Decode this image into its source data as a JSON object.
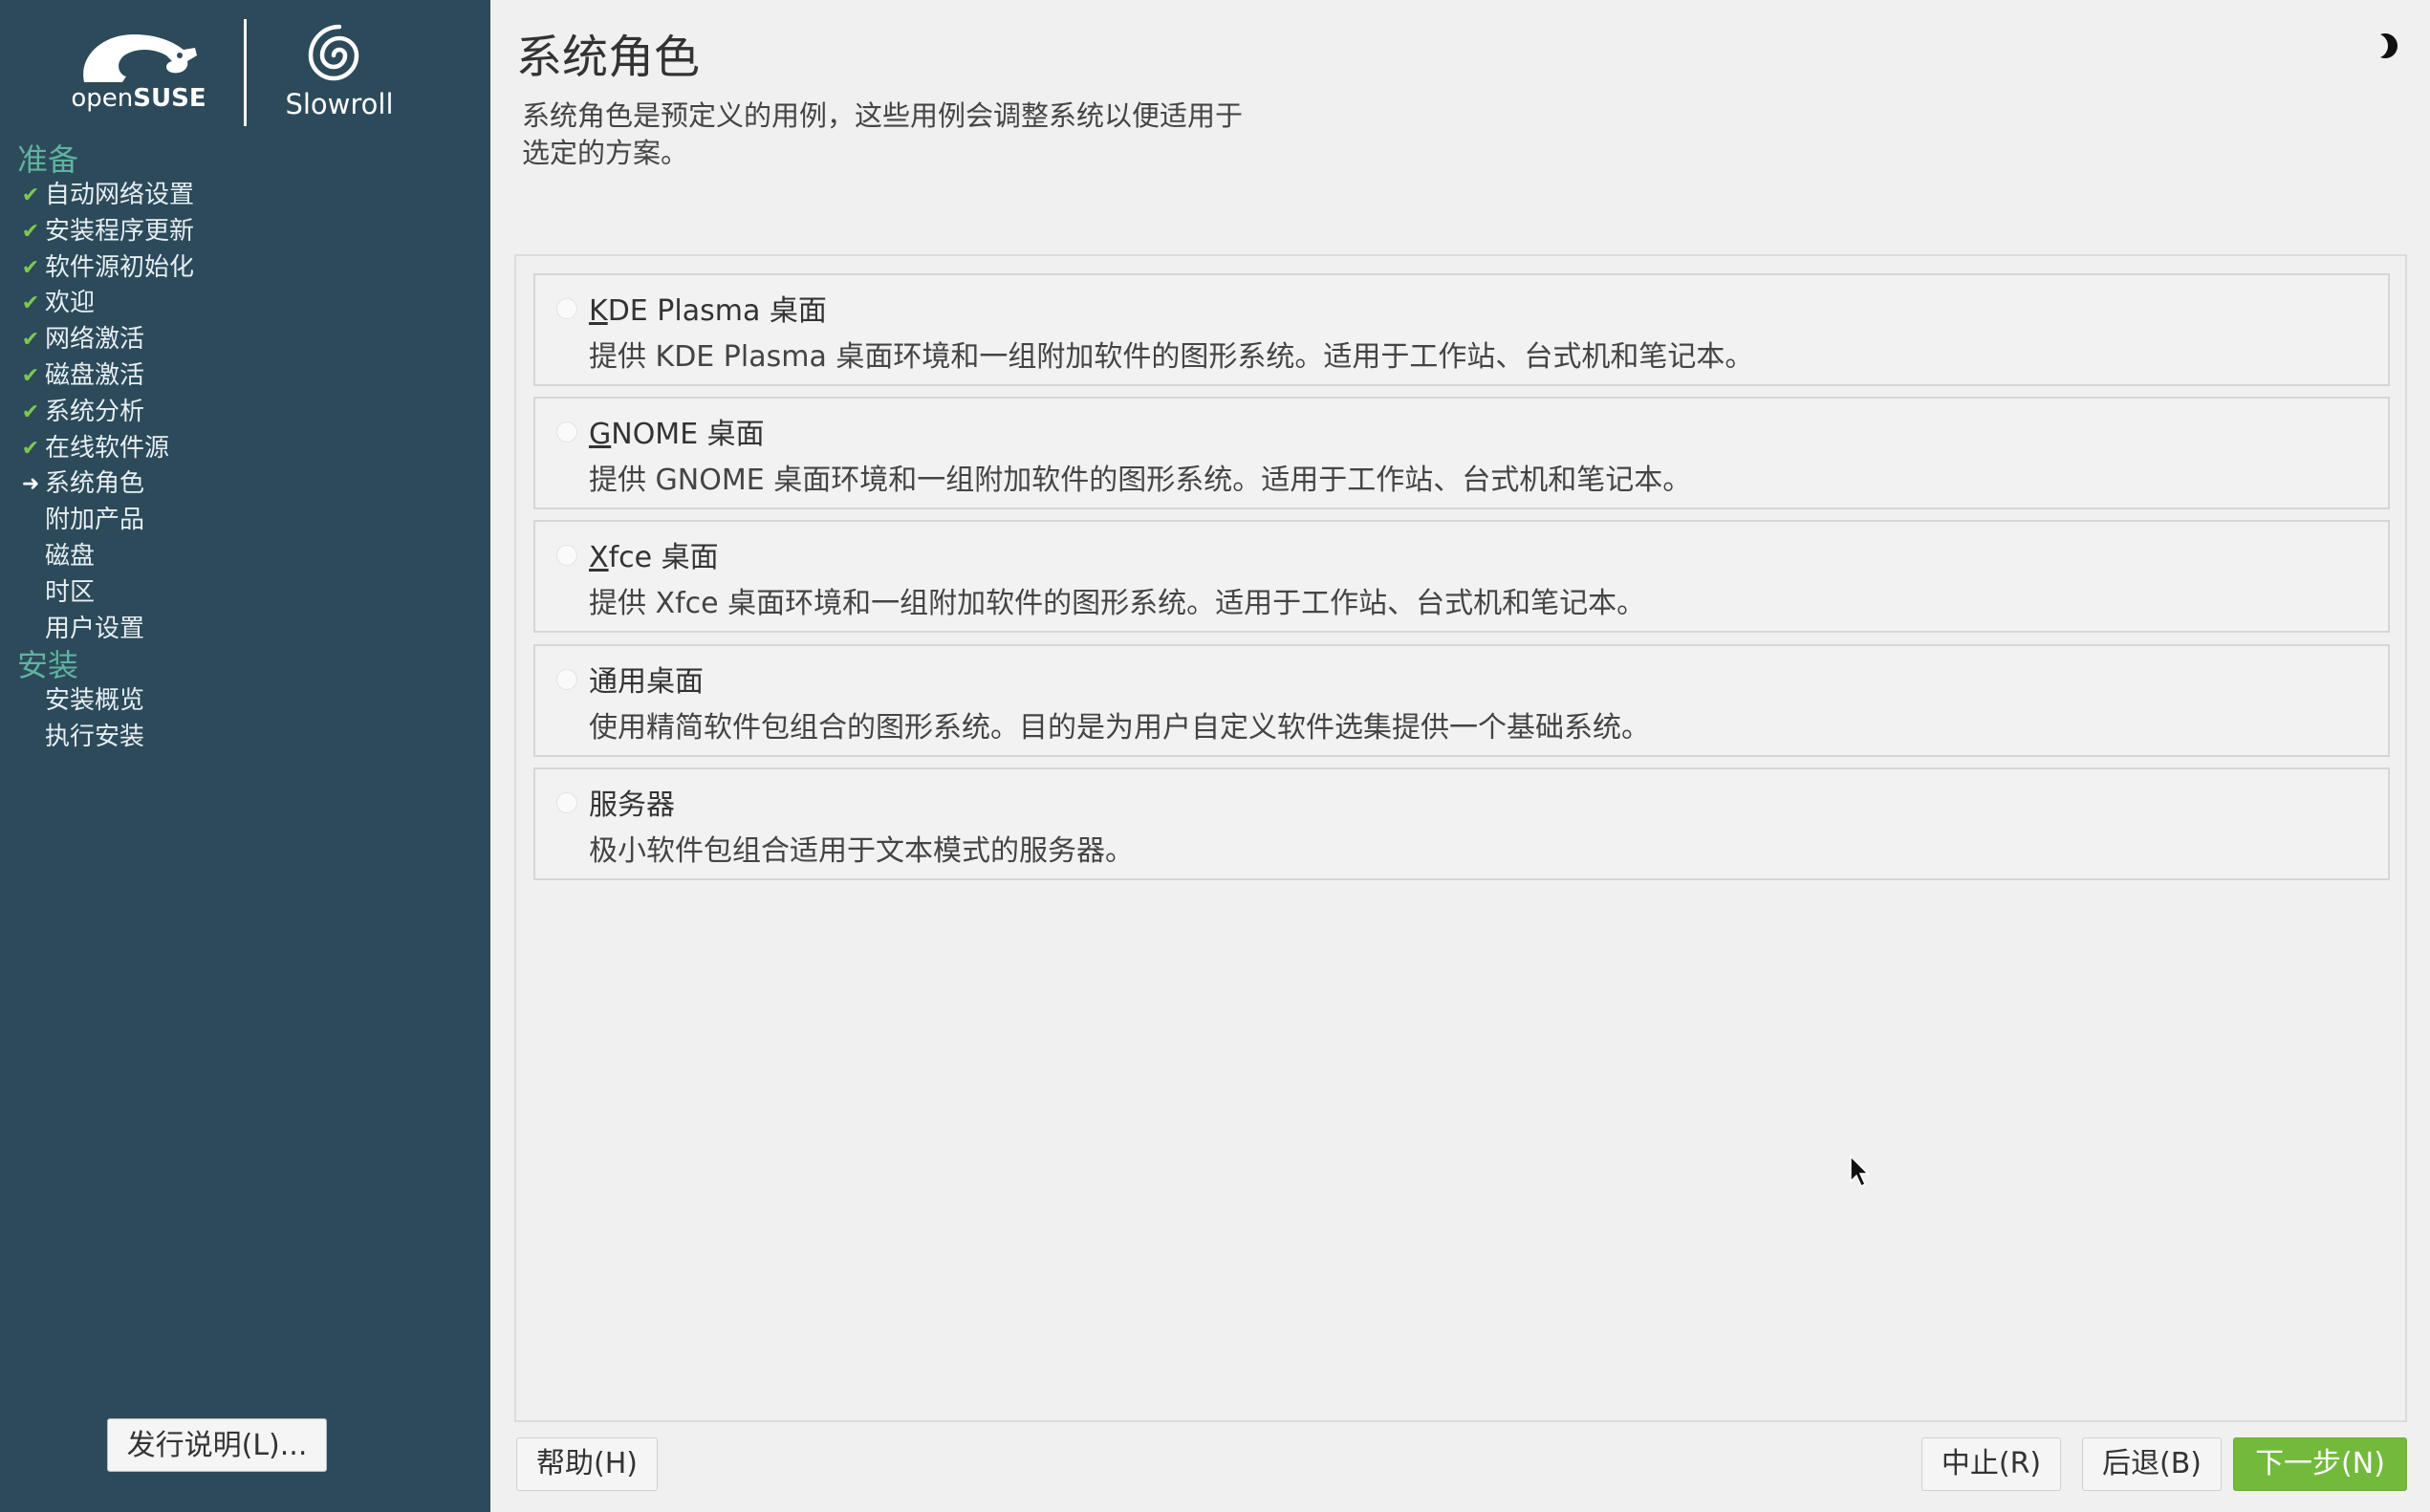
{
  "branding": {
    "opensuse_prefix": "open",
    "opensuse_suffix": "SUSE",
    "slowroll": "Slowroll"
  },
  "sidebar": {
    "sections": [
      {
        "label": "准备",
        "items": [
          {
            "label": "自动网络设置",
            "state": "done"
          },
          {
            "label": "安装程序更新",
            "state": "done"
          },
          {
            "label": "软件源初始化",
            "state": "done"
          },
          {
            "label": "欢迎",
            "state": "done"
          },
          {
            "label": "网络激活",
            "state": "done"
          },
          {
            "label": "磁盘激活",
            "state": "done"
          },
          {
            "label": "系统分析",
            "state": "done"
          },
          {
            "label": "在线软件源",
            "state": "done"
          },
          {
            "label": "系统角色",
            "state": "current"
          },
          {
            "label": "附加产品",
            "state": "pending"
          },
          {
            "label": "磁盘",
            "state": "pending"
          },
          {
            "label": "时区",
            "state": "pending"
          },
          {
            "label": "用户设置",
            "state": "pending"
          }
        ]
      },
      {
        "label": "安装",
        "items": [
          {
            "label": "安装概览",
            "state": "pending"
          },
          {
            "label": "执行安装",
            "state": "pending"
          }
        ]
      }
    ],
    "release_notes_button": "发行说明(L)..."
  },
  "main": {
    "title": "系统角色",
    "description_line1": "系统角色是预定义的用例，这些用例会调整系统以便适用于",
    "description_line2": "选定的方案。",
    "roles": [
      {
        "mnemonic": "K",
        "title_rest": "DE Plasma 桌面",
        "description": "提供 KDE Plasma 桌面环境和一组附加软件的图形系统。适用于工作站、台式机和笔记本。",
        "selected": false
      },
      {
        "mnemonic": "G",
        "title_rest": "NOME 桌面",
        "description": "提供 GNOME 桌面环境和一组附加软件的图形系统。适用于工作站、台式机和笔记本。",
        "selected": false
      },
      {
        "mnemonic": "X",
        "title_rest": "fce 桌面",
        "description": "提供 Xfce 桌面环境和一组附加软件的图形系统。适用于工作站、台式机和笔记本。",
        "selected": false
      },
      {
        "mnemonic": "",
        "title_rest": "通用桌面",
        "description": "使用精简软件包组合的图形系统。目的是为用户自定义软件选集提供一个基础系统。",
        "selected": false
      },
      {
        "mnemonic": "",
        "title_rest": "服务器",
        "description": "极小软件包组合适用于文本模式的服务器。",
        "selected": false
      }
    ]
  },
  "buttons": {
    "help": "帮助(H)",
    "abort": "中止(R)",
    "back": "后退(B)",
    "next": "下一步(N)"
  },
  "colors": {
    "sidebar_bg": "#2c4a5a",
    "section_label": "#5fb3a0",
    "check": "#7ec850",
    "next_button": "#73ba3c"
  },
  "icons": [
    "opensuse-chameleon-icon",
    "slowroll-spiral-icon",
    "check-icon",
    "arrow-right-icon",
    "theme-toggle-icon",
    "mouse-cursor-icon"
  ]
}
